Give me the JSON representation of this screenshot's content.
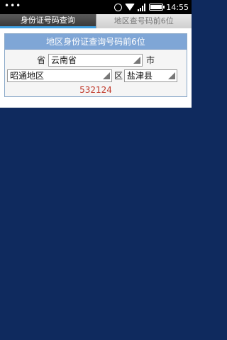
{
  "status_bar": {
    "left_dots": "•••",
    "time": "14:55"
  },
  "tabs": [
    {
      "label": "身份证号码查询",
      "active": true
    },
    {
      "label": "地区查号码前6位",
      "active": false
    }
  ],
  "panel": {
    "title": "地区身份证查询号码前6位",
    "province_label": "省",
    "province_value": "云南省",
    "city_label": "市",
    "city_value": "昭通地区",
    "district_label": "区",
    "district_value": "盐津县",
    "result": "532124"
  },
  "colors": {
    "background": "#0f2a5e",
    "header": "#7fa6d6",
    "result": "#c0392b",
    "tab_indicator": "#3f9fe0"
  }
}
